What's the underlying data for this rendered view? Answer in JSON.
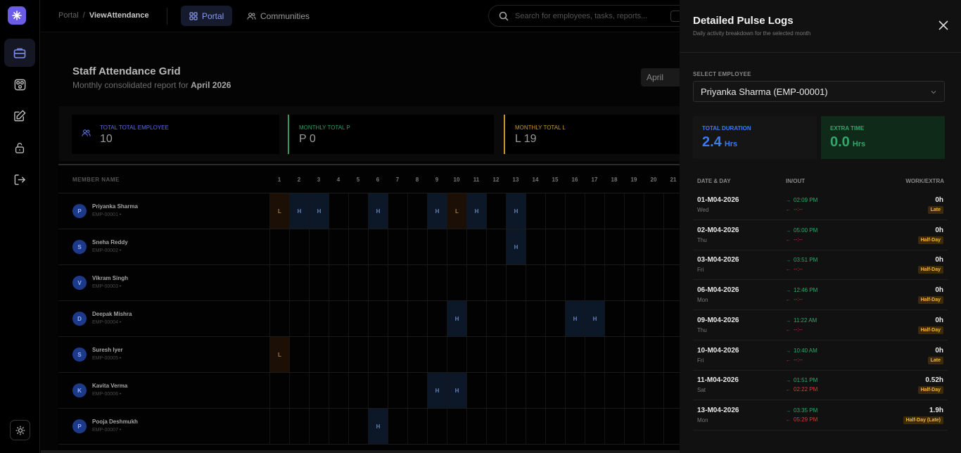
{
  "breadcrumb": {
    "root": "Portal",
    "current": "ViewAttendance"
  },
  "nav": {
    "portal": "Portal",
    "communities": "Communities"
  },
  "search": {
    "placeholder": "Search for employees, tasks, reports..."
  },
  "page": {
    "title": "Staff Attendance Grid",
    "subtitle_prefix": "Monthly consolidated report for",
    "subtitle_period": "April 2026",
    "month_select": "April"
  },
  "stats": [
    {
      "label": "Total Total Employee",
      "value": "10",
      "color": "#5a6fd8"
    },
    {
      "label": "Monthly Total P",
      "value": "P 0",
      "color": "#2f9e5f"
    },
    {
      "label": "Monthly Total L",
      "value": "L 19",
      "color": "#c9952b"
    }
  ],
  "grid": {
    "member_header": "MEMBER NAME",
    "days": [
      "1",
      "2",
      "3",
      "4",
      "5",
      "6",
      "7",
      "8",
      "9",
      "10",
      "11",
      "12",
      "13",
      "14",
      "15",
      "16",
      "17",
      "18",
      "19",
      "20",
      "21"
    ],
    "rows": [
      {
        "initial": "P",
        "name": "Priyanka Sharma",
        "id": "EMP-00001 •",
        "marks": {
          "1": "L",
          "2": "H",
          "3": "H",
          "6": "H",
          "9": "H",
          "10": "L",
          "11": "H",
          "13": "H"
        }
      },
      {
        "initial": "S",
        "name": "Sneha Reddy",
        "id": "EMP-00002 •",
        "marks": {
          "13": "H"
        }
      },
      {
        "initial": "V",
        "name": "Vikram Singh",
        "id": "EMP-00003 •",
        "marks": {}
      },
      {
        "initial": "D",
        "name": "Deepak Mishra",
        "id": "EMP-00004 •",
        "marks": {
          "10": "H",
          "16": "H",
          "17": "H"
        }
      },
      {
        "initial": "S",
        "name": "Suresh Iyer",
        "id": "EMP-00005 •",
        "marks": {
          "1": "L"
        }
      },
      {
        "initial": "K",
        "name": "Kavita Verma",
        "id": "EMP-00006 •",
        "marks": {
          "9": "H",
          "10": "H"
        }
      },
      {
        "initial": "P",
        "name": "Pooja Deshmukh",
        "id": "EMP-00007 •",
        "marks": {
          "6": "H"
        }
      }
    ]
  },
  "drawer": {
    "title": "Detailed Pulse Logs",
    "subtitle": "Daily activity breakdown for the selected month",
    "select_label": "SELECT EMPLOYEE",
    "selected_employee": "Priyanka Sharma (EMP-00001)",
    "total_label": "TOTAL DURATION",
    "total_value": "2.4",
    "total_unit": "Hrs",
    "extra_label": "EXTRA TIME",
    "extra_value": "0.0",
    "extra_unit": "Hrs",
    "headers": {
      "date": "DATE & DAY",
      "inout": "IN/OUT",
      "work": "WORK/EXTRA"
    },
    "logs": [
      {
        "date": "01-M04-2026",
        "day": "Wed",
        "in": "02:09 PM",
        "out": "--:--",
        "work": "0h",
        "status": "Late"
      },
      {
        "date": "02-M04-2026",
        "day": "Thu",
        "in": "05:00 PM",
        "out": "--:--",
        "work": "0h",
        "status": "Half-Day"
      },
      {
        "date": "03-M04-2026",
        "day": "Fri",
        "in": "03:51 PM",
        "out": "--:--",
        "work": "0h",
        "status": "Half-Day"
      },
      {
        "date": "06-M04-2026",
        "day": "Mon",
        "in": "12:46 PM",
        "out": "--:--",
        "work": "0h",
        "status": "Half-Day"
      },
      {
        "date": "09-M04-2026",
        "day": "Thu",
        "in": "11:22 AM",
        "out": "--:--",
        "work": "0h",
        "status": "Half-Day"
      },
      {
        "date": "10-M04-2026",
        "day": "Fri",
        "in": "10:40 AM",
        "out": "--:--",
        "work": "0h",
        "status": "Late"
      },
      {
        "date": "11-M04-2026",
        "day": "Sat",
        "in": "01:51 PM",
        "out": "02:22 PM",
        "work": "0.52h",
        "status": "Half-Day"
      },
      {
        "date": "13-M04-2026",
        "day": "Mon",
        "in": "03:35 PM",
        "out": "05:29 PM",
        "work": "1.9h",
        "status": "Half-Day (Late)"
      }
    ]
  }
}
